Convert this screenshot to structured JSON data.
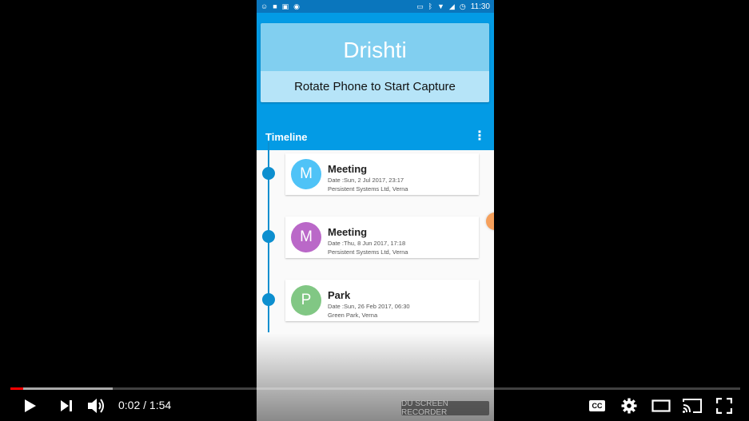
{
  "status_bar": {
    "time": "11:30",
    "left_icons": [
      "emoji-icon",
      "video-camera-icon",
      "image-icon",
      "record-icon"
    ],
    "right_icons": [
      "cast-icon",
      "bluetooth-icon",
      "wifi-icon",
      "signal-icon",
      "signal-icon",
      "alarm-icon"
    ]
  },
  "app": {
    "title": "Drishti",
    "subtitle": "Rotate Phone to Start Capture",
    "toolbar_title": "Timeline",
    "overflow_glyph": "⋮",
    "colors": {
      "primary": "#039be5",
      "status_bar": "#0a76bd",
      "timeline": "#0d8fcf"
    }
  },
  "events": [
    {
      "initial": "M",
      "title": "Meeting",
      "date": "Date :Sun, 2 Jul 2017, 23:17",
      "place": "Persistent Systems Ltd, Verna",
      "color": "#4fc3f7"
    },
    {
      "initial": "M",
      "title": "Meeting",
      "date": "Date :Thu, 8 Jun 2017, 17:18",
      "place": "Persistent Systems Ltd, Verna",
      "color": "#ba68c8"
    },
    {
      "initial": "P",
      "title": "Park",
      "date": "Date :Sun, 26 Feb 2017, 06:30",
      "place": "Green Park, Verna",
      "color": "#81c784"
    }
  ],
  "watermark": "DU SCREEN RECORDER",
  "player": {
    "current_time": "0:02",
    "separator": " / ",
    "duration": "1:54",
    "played_fraction": 0.018,
    "buffered_fraction": 0.14,
    "cc_label": "CC",
    "accent": "#ff0000"
  }
}
